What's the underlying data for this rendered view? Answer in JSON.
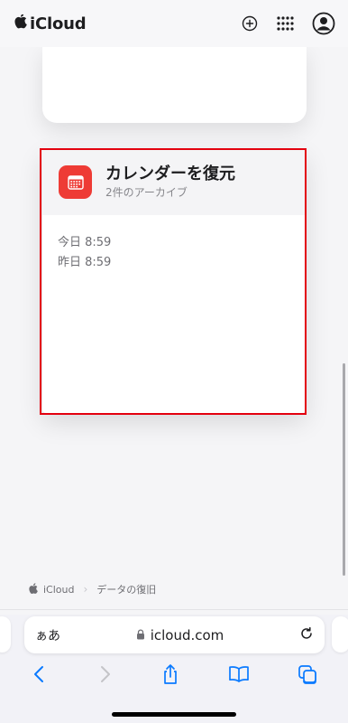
{
  "header": {
    "brand": "iCloud"
  },
  "card": {
    "title": "カレンダーを復元",
    "subtitle": "2件のアーカイブ",
    "entries": [
      "今日 8:59",
      "昨日 8:59"
    ]
  },
  "breadcrumb": {
    "home": "iCloud",
    "current": "データの復旧"
  },
  "safari": {
    "aa_label": "ぁあ",
    "url": "icloud.com"
  },
  "colors": {
    "accent_red": "#ee3b35",
    "highlight": "#e3000f",
    "safari_blue": "#0a7aff"
  },
  "icons": [
    "apple-logo-icon",
    "add-icon",
    "app-grid-icon",
    "account-icon",
    "calendar-icon",
    "lock-icon",
    "reload-icon",
    "back-icon",
    "forward-icon",
    "share-icon",
    "bookmarks-icon",
    "tabs-icon"
  ]
}
